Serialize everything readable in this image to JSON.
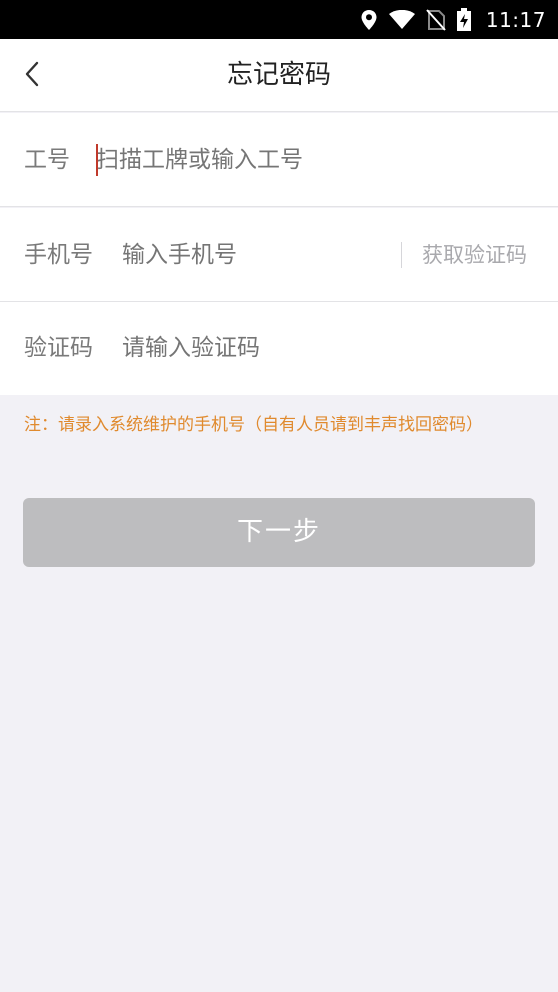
{
  "status_bar": {
    "time": "11:17",
    "icons": [
      "location-icon",
      "wifi-icon",
      "no-sim-icon",
      "battery-charging-icon"
    ]
  },
  "nav": {
    "title": "忘记密码",
    "back_icon": "chevron-left-icon"
  },
  "form": {
    "employee_id": {
      "label": "工号",
      "placeholder": "扫描工牌或输入工号",
      "value": ""
    },
    "phone": {
      "label": "手机号",
      "placeholder": "输入手机号",
      "value": "",
      "get_code_label": "获取验证码"
    },
    "code": {
      "label": "验证码",
      "placeholder": "请输入验证码",
      "value": ""
    }
  },
  "notice": "注：请录入系统维护的手机号（自有人员请到丰声找回密码）",
  "next_button": "下一步",
  "colors": {
    "notice": "#e08a2e",
    "button_disabled": "#bdbdbf",
    "background": "#f2f1f6",
    "caret": "#c0392b"
  }
}
